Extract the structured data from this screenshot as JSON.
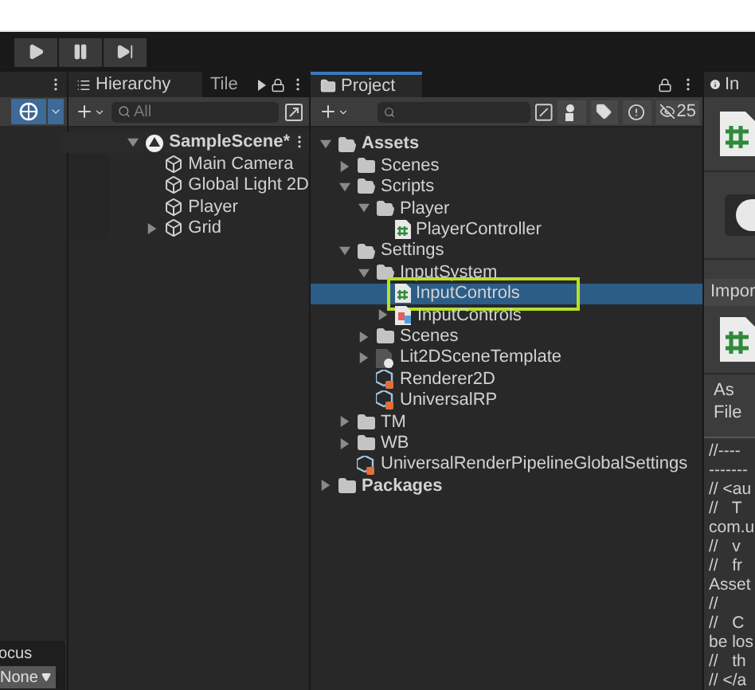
{
  "toolbar": {
    "buttons": [
      {
        "kind": "play"
      },
      {
        "kind": "pause"
      },
      {
        "kind": "step"
      }
    ]
  },
  "scene_panel": {
    "overlay_label": "ocus",
    "dropdown": "None"
  },
  "hierarchy": {
    "tabs": [
      {
        "label": "Hierarchy",
        "selected": true
      },
      {
        "label": "Tile",
        "selected": false
      }
    ],
    "search": {
      "placeholder": "All"
    },
    "tree": [
      {
        "label": "SampleScene*",
        "kind": "scene",
        "expanded": true,
        "children": [
          {
            "label": "Main Camera",
            "kind": "object"
          },
          {
            "label": "Global Light 2D",
            "kind": "object"
          },
          {
            "label": "Player",
            "kind": "object"
          },
          {
            "label": "Grid",
            "kind": "object",
            "expanded": false
          }
        ]
      }
    ]
  },
  "project": {
    "tab": {
      "label": "Project",
      "selected": true
    },
    "hidden_count": "25",
    "tree": [
      {
        "label": "Assets",
        "kind": "folder",
        "expanded": true,
        "children": [
          {
            "label": "Scenes",
            "kind": "folder",
            "expanded": false
          },
          {
            "label": "Scripts",
            "kind": "folder",
            "expanded": true,
            "children": [
              {
                "label": "Player",
                "kind": "folder",
                "expanded": true,
                "children": [
                  {
                    "label": "PlayerController",
                    "kind": "script"
                  }
                ]
              }
            ]
          },
          {
            "label": "Settings",
            "kind": "folder",
            "expanded": true,
            "children": [
              {
                "label": "InputSystem",
                "kind": "folder",
                "expanded": true,
                "children": [
                  {
                    "label": "InputControls",
                    "kind": "script",
                    "selected": true
                  },
                  {
                    "label": "InputControls",
                    "kind": "actions",
                    "expanded": false
                  }
                ]
              },
              {
                "label": "Scenes",
                "kind": "folder",
                "expanded": false
              },
              {
                "label": "Lit2DSceneTemplate",
                "kind": "template",
                "expanded": false
              },
              {
                "label": "Renderer2D",
                "kind": "asset"
              },
              {
                "label": "UniversalRP",
                "kind": "asset"
              }
            ]
          },
          {
            "label": "TM",
            "kind": "folder",
            "expanded": false
          },
          {
            "label": "WB",
            "kind": "folder",
            "expanded": false
          },
          {
            "label": "UniversalRenderPipelineGlobalSettings",
            "kind": "asset"
          }
        ]
      },
      {
        "label": "Packages",
        "kind": "folder",
        "expanded": false
      }
    ]
  },
  "inspector": {
    "tab": {
      "label": "In",
      "selected": true
    },
    "section": "Impor",
    "labels": [
      "As",
      "File"
    ],
    "code": [
      "//----",
      "-------",
      "// <au",
      "//   T",
      "com.u",
      "//   v",
      "//   fr",
      "Asset",
      "//",
      "//   C",
      "be los",
      "//   th",
      "// </a"
    ]
  }
}
